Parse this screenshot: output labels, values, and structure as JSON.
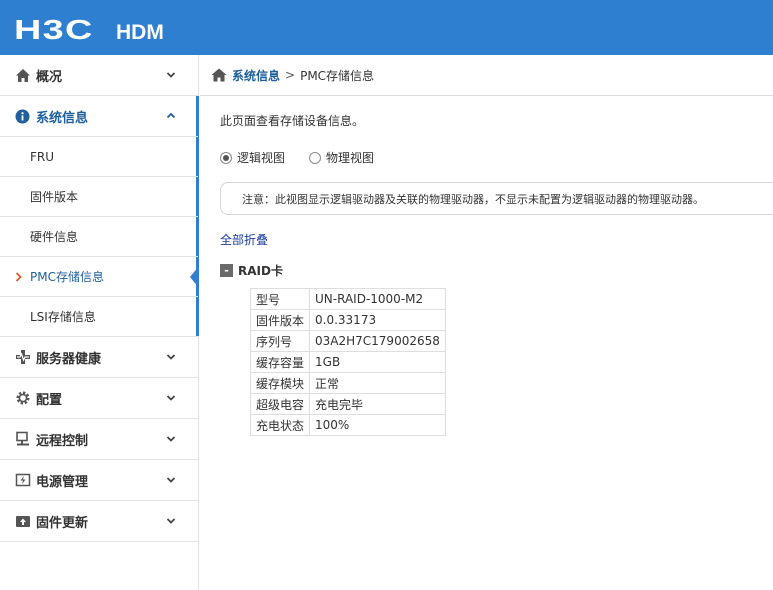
{
  "header": {
    "logo_main": "H3C",
    "logo_sub": "HDM",
    "bg_color": "#2f7fd0"
  },
  "sidebar": {
    "groups": [
      {
        "label": "概况",
        "icon": "home-icon",
        "expanded": false
      },
      {
        "label": "系统信息",
        "icon": "info-icon",
        "expanded": true,
        "children": [
          "FRU",
          "固件版本",
          "硬件信息",
          "PMC存储信息",
          "LSI存储信息"
        ],
        "active_child": "PMC存储信息"
      },
      {
        "label": "服务器健康",
        "icon": "health-icon",
        "expanded": false
      },
      {
        "label": "配置",
        "icon": "gear-icon",
        "expanded": false
      },
      {
        "label": "远程控制",
        "icon": "remote-icon",
        "expanded": false
      },
      {
        "label": "电源管理",
        "icon": "power-icon",
        "expanded": false
      },
      {
        "label": "固件更新",
        "icon": "firmware-update-icon",
        "expanded": false
      }
    ]
  },
  "breadcrumb": {
    "parent": "系统信息",
    "separator": ">",
    "current": "PMC存储信息"
  },
  "main": {
    "description": "此页面查看存储设备信息。",
    "view_options": [
      {
        "label": "逻辑视图",
        "selected": true
      },
      {
        "label": "物理视图",
        "selected": false
      }
    ],
    "notice": "注意：此视图显示逻辑驱动器及关联的物理驱动器，不显示未配置为逻辑驱动器的物理驱动器。",
    "collapse_all": "全部折叠",
    "raid_section": {
      "toggle": "-",
      "title": "RAID卡",
      "properties": [
        {
          "key": "型号",
          "value": "UN-RAID-1000-M2"
        },
        {
          "key": "固件版本",
          "value": "0.0.33173"
        },
        {
          "key": "序列号",
          "value": "03A2H7C179002658"
        },
        {
          "key": "缓存容量",
          "value": "1GB"
        },
        {
          "key": "缓存模块",
          "value": "正常"
        },
        {
          "key": "超级电容",
          "value": "充电完毕"
        },
        {
          "key": "充电状态",
          "value": "100%"
        }
      ]
    }
  },
  "colors": {
    "accent": "#2f7fd0",
    "link": "#1f5f9c",
    "marker": "#e0562b"
  }
}
